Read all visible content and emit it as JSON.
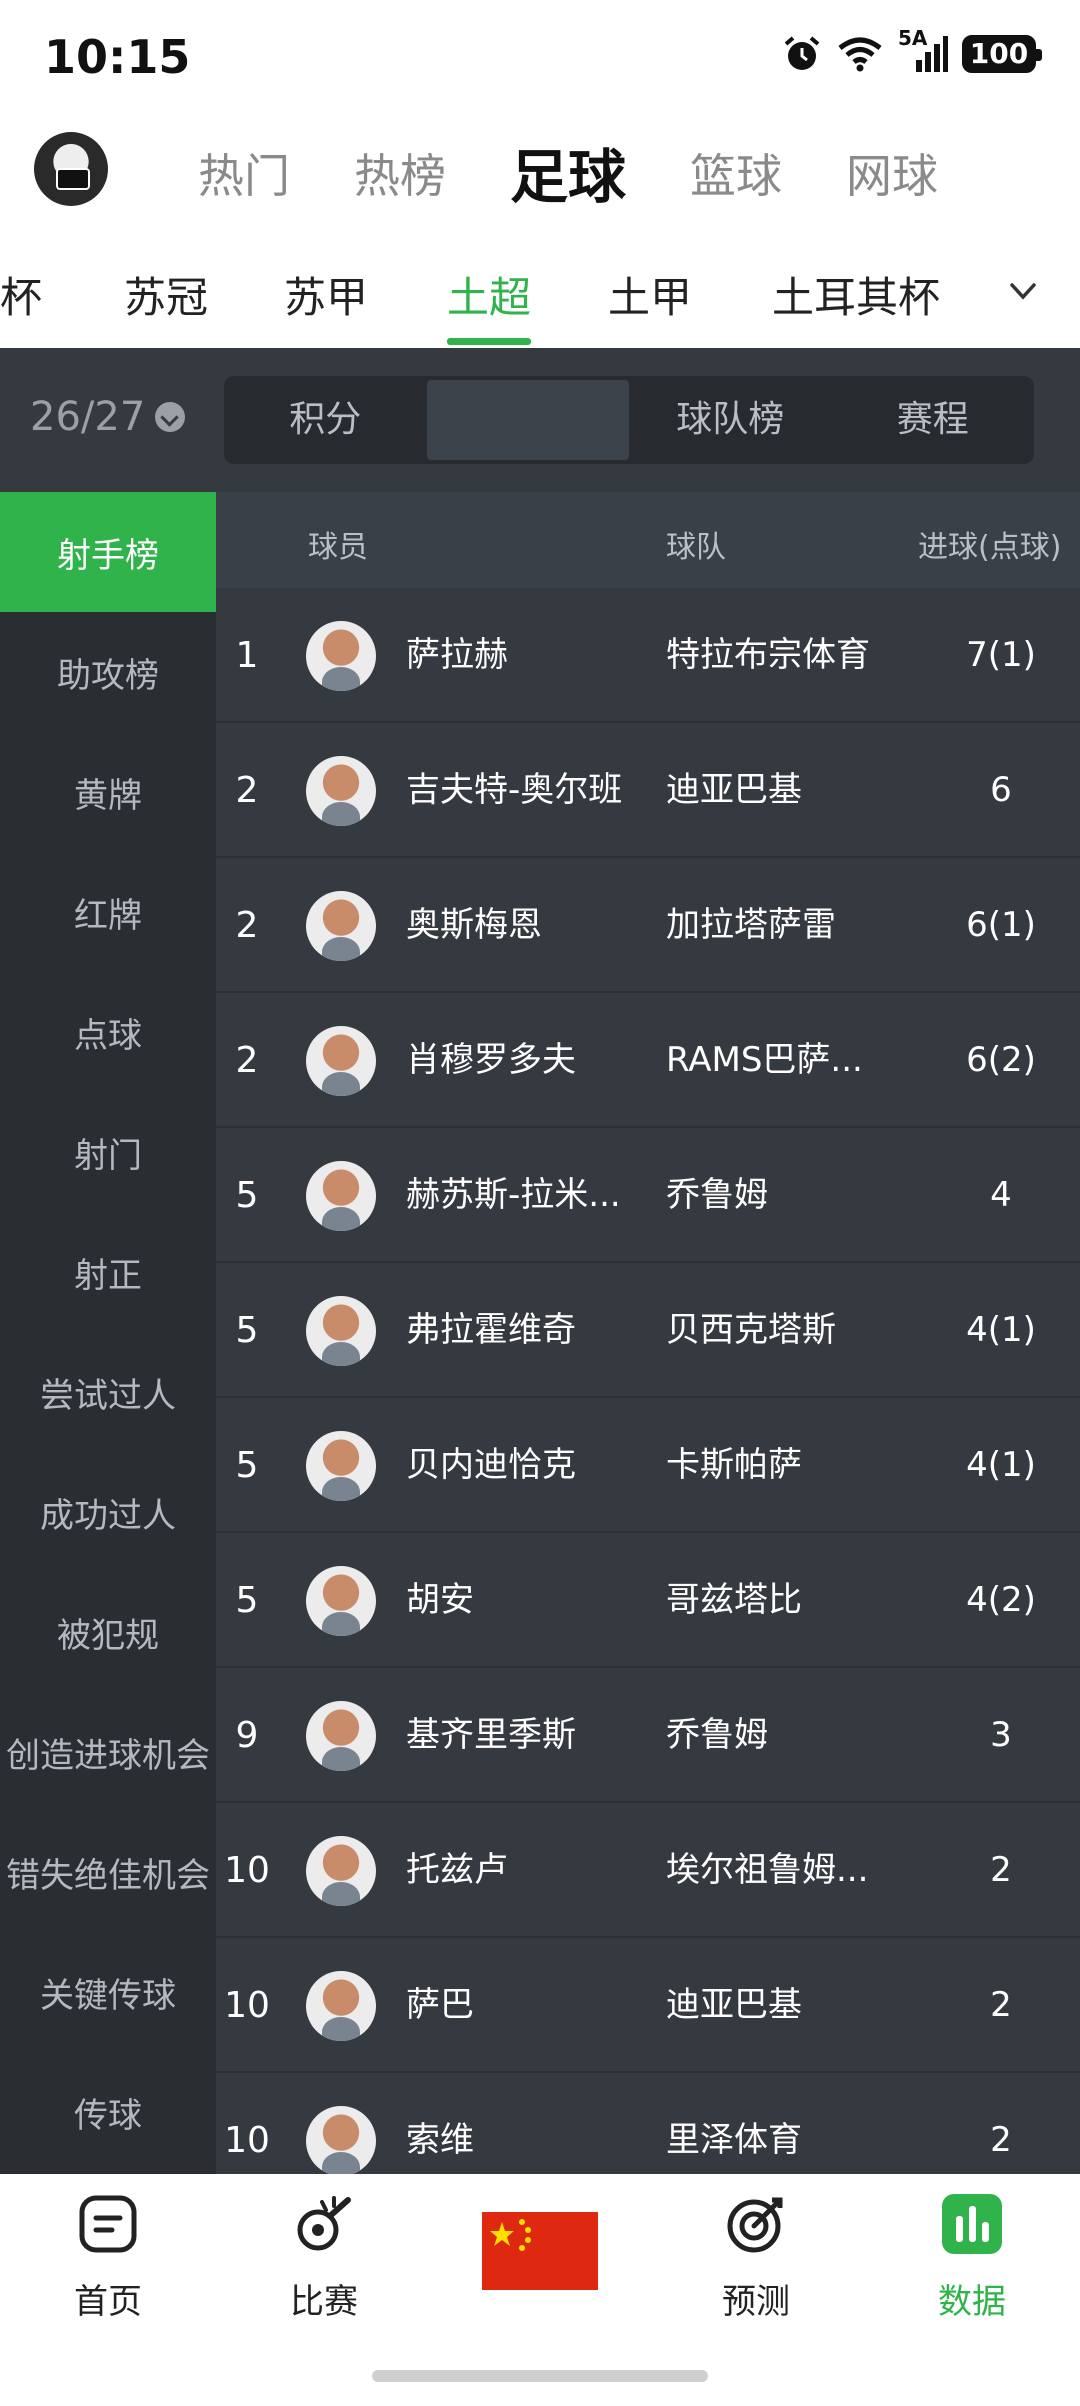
{
  "status": {
    "time": "10:15",
    "network": "5A",
    "battery": "100"
  },
  "sport_tabs": [
    "热门",
    "热榜",
    "足球",
    "篮球",
    "网球"
  ],
  "league_tabs": [
    "杯",
    "苏冠",
    "苏甲",
    "土超",
    "土甲",
    "土耳其杯"
  ],
  "season": "26/27",
  "segments": [
    "积分",
    "",
    "球队榜",
    "赛程"
  ],
  "sidebar_items": [
    "射手榜",
    "助攻榜",
    "黄牌",
    "红牌",
    "点球",
    "射门",
    "射正",
    "尝试过人",
    "成功过人",
    "被犯规",
    "创造进球机会",
    "错失绝佳机会",
    "关键传球",
    "传球"
  ],
  "table_header": {
    "player": "球员",
    "team": "球队",
    "goals": "进球(点球)"
  },
  "rows": [
    {
      "rank": "1",
      "name": "萨拉赫",
      "team": "特拉布宗体育",
      "goals": "7(1)"
    },
    {
      "rank": "2",
      "name": "吉夫特-奥尔班",
      "team": "迪亚巴基",
      "goals": "6"
    },
    {
      "rank": "2",
      "name": "奥斯梅恩",
      "team": "加拉塔萨雷",
      "goals": "6(1)"
    },
    {
      "rank": "2",
      "name": "肖穆罗多夫",
      "team": "RAMS巴萨...",
      "goals": "6(2)"
    },
    {
      "rank": "5",
      "name": "赫苏斯-拉米...",
      "team": "乔鲁姆",
      "goals": "4"
    },
    {
      "rank": "5",
      "name": "弗拉霍维奇",
      "team": "贝西克塔斯",
      "goals": "4(1)"
    },
    {
      "rank": "5",
      "name": "贝内迪恰克",
      "team": "卡斯帕萨",
      "goals": "4(1)"
    },
    {
      "rank": "5",
      "name": "胡安",
      "team": "哥兹塔比",
      "goals": "4(2)"
    },
    {
      "rank": "9",
      "name": "基齐里季斯",
      "team": "乔鲁姆",
      "goals": "3"
    },
    {
      "rank": "10",
      "name": "托兹卢",
      "team": "埃尔祖鲁姆...",
      "goals": "2"
    },
    {
      "rank": "10",
      "name": "萨巴",
      "team": "迪亚巴基",
      "goals": "2"
    },
    {
      "rank": "10",
      "name": "索维",
      "team": "里泽体育",
      "goals": "2"
    }
  ],
  "bottom_nav": [
    "首页",
    "比赛",
    "",
    "预测",
    "数据"
  ],
  "colors": {
    "accent": "#2fb34a",
    "dark_bg": "#353a40",
    "sidebar_bg": "#2a2e33"
  }
}
